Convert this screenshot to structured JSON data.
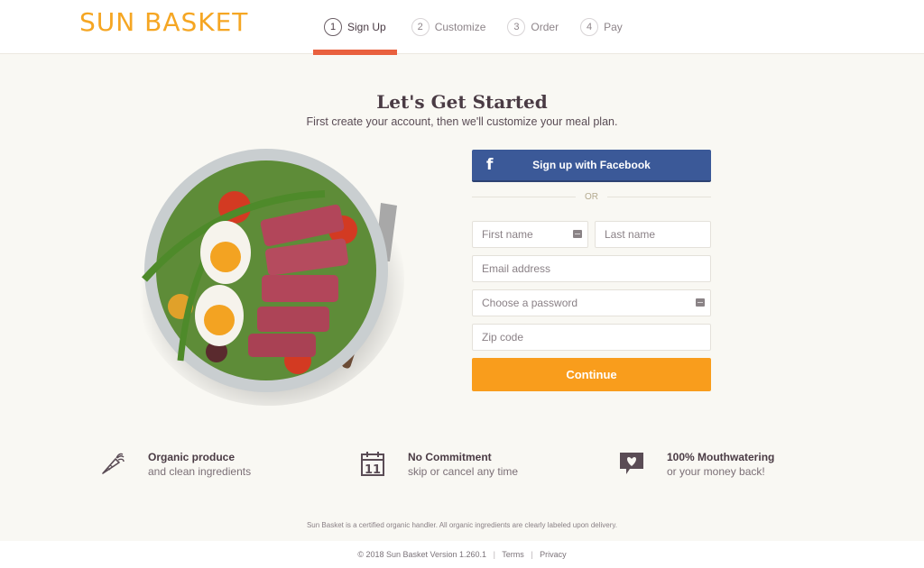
{
  "header": {
    "logo": "SUN BASKET",
    "steps": [
      {
        "num": "1",
        "label": "Sign Up",
        "active": true
      },
      {
        "num": "2",
        "label": "Customize",
        "active": false
      },
      {
        "num": "3",
        "label": "Order",
        "active": false
      },
      {
        "num": "4",
        "label": "Pay",
        "active": false
      }
    ],
    "accent_color": "#e9603e"
  },
  "main": {
    "title": "Let's Get Started",
    "subtitle": "First create your account, then we'll customize your meal plan.",
    "hero_alt": "salad-bowl-with-seared-tuna-and-eggs"
  },
  "form": {
    "facebook_label": "Sign up with Facebook",
    "facebook_icon": "f",
    "or_label": "OR",
    "first_name": {
      "placeholder": "First name",
      "value": ""
    },
    "last_name": {
      "placeholder": "Last name",
      "value": ""
    },
    "email": {
      "placeholder": "Email address",
      "value": ""
    },
    "password": {
      "placeholder": "Choose a password",
      "value": ""
    },
    "zip": {
      "placeholder": "Zip code",
      "value": ""
    },
    "continue_label": "Continue",
    "facebook_color": "#3b5998",
    "continue_color": "#f99d1c"
  },
  "features": [
    {
      "icon": "carrot-icon",
      "title": "Organic produce",
      "subtitle": "and clean ingredients"
    },
    {
      "icon": "calendar-icon",
      "title": "No Commitment",
      "subtitle": "skip or cancel any time"
    },
    {
      "icon": "heart-speech-icon",
      "title": "100% Mouthwatering",
      "subtitle": "or your money back!"
    }
  ],
  "note": "Sun Basket is a certified organic handler. All organic ingredients are clearly labeled upon delivery.",
  "footer": {
    "copyright": "© 2018 Sun Basket Version 1.260.1",
    "terms": "Terms",
    "privacy": "Privacy"
  }
}
